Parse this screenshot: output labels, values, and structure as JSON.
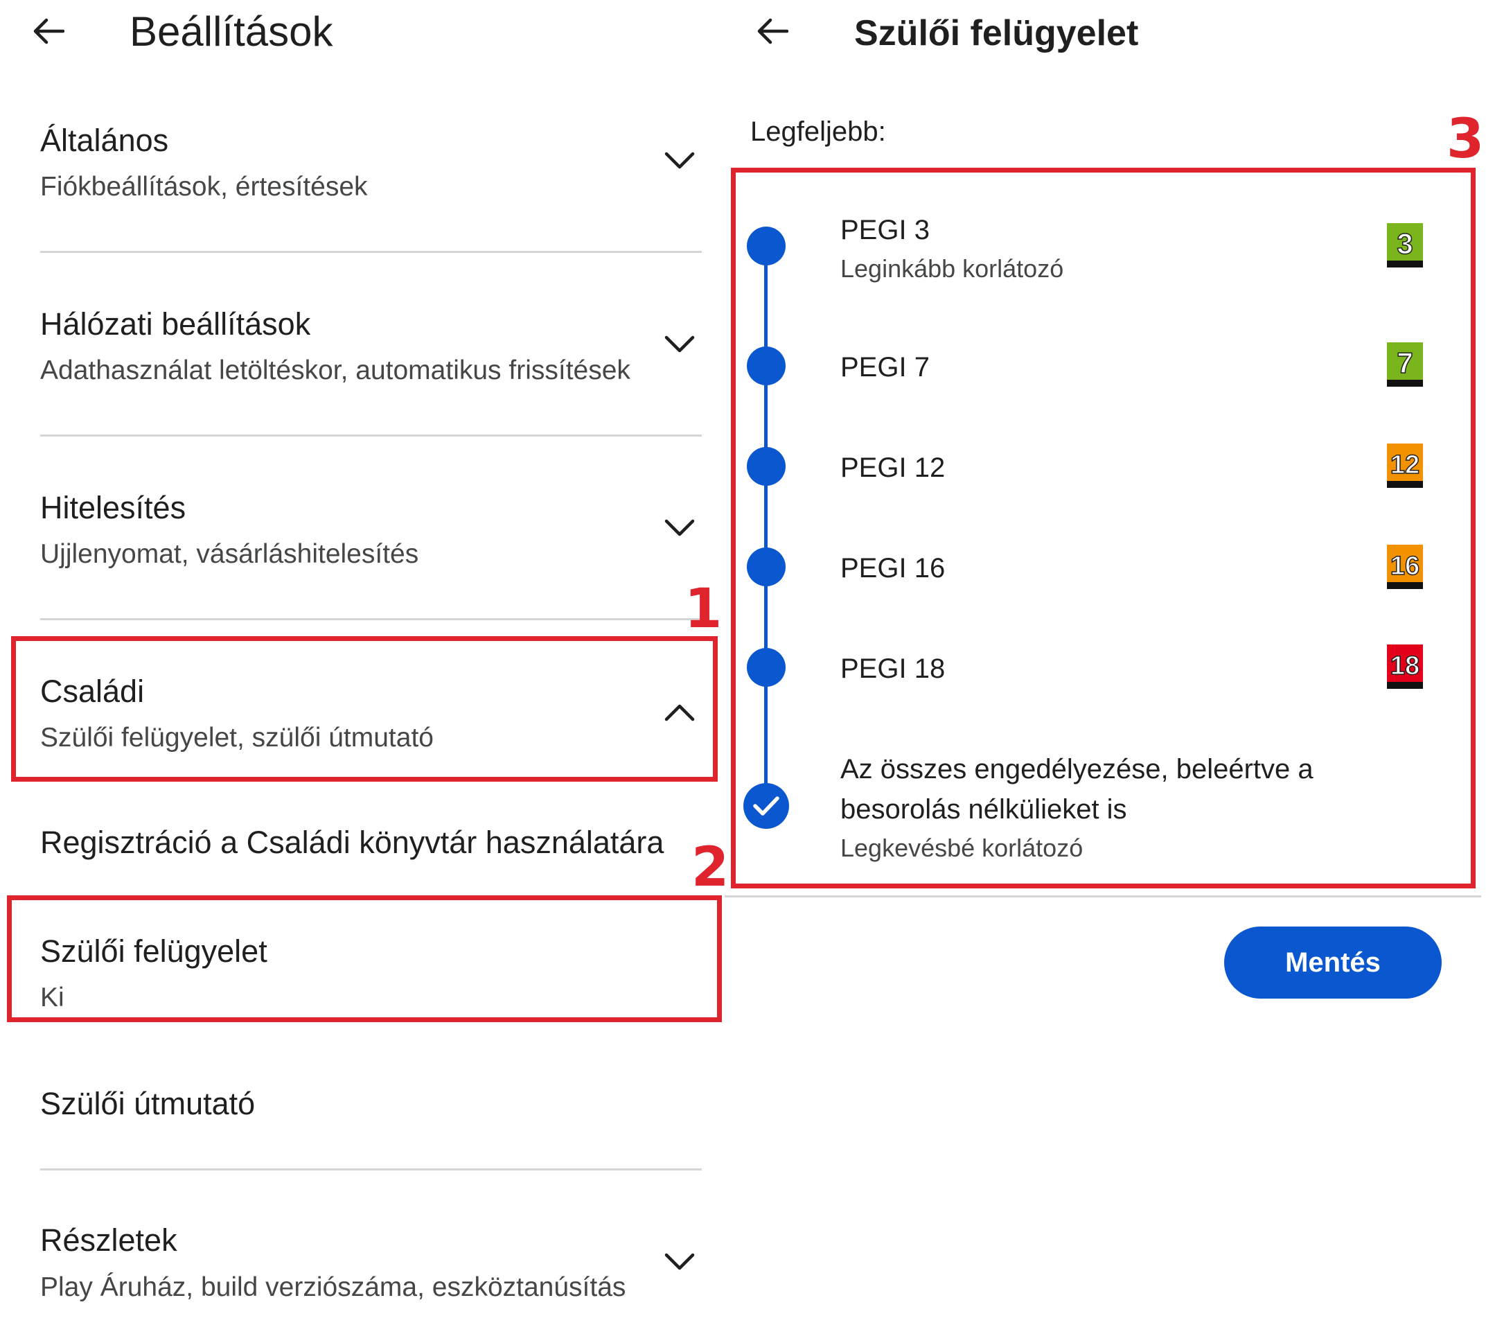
{
  "left": {
    "title": "Beállítások",
    "items": [
      {
        "title": "Általános",
        "subtitle": "Fiókbeállítások, értesítések"
      },
      {
        "title": "Hálózati beállítások",
        "subtitle": "Adathasználat letöltéskor, automatikus frissítések"
      },
      {
        "title": "Hitelesítés",
        "subtitle": "Ujjlenyomat, vásárláshitelesítés"
      },
      {
        "title": "Családi",
        "subtitle": "Szülői felügyelet, szülői útmutató"
      }
    ],
    "family_register": "Regisztráció a Családi könyvtár használatára",
    "parental_control": {
      "title": "Szülői felügyelet",
      "value": "Ki"
    },
    "parental_guide": "Szülői útmutató",
    "details": {
      "title": "Részletek",
      "subtitle": "Play Áruház, build verziószáma, eszköztanúsítás"
    }
  },
  "right": {
    "title": "Szülői felügyelet",
    "max_label": "Legfeljebb:",
    "options": [
      {
        "label": "PEGI 3",
        "sub": "Leginkább korlátozó",
        "badge": "3",
        "badge_color": "#7ab51d"
      },
      {
        "label": "PEGI 7",
        "badge": "7",
        "badge_color": "#7ab51d"
      },
      {
        "label": "PEGI 12",
        "badge": "12",
        "badge_color": "#f39200"
      },
      {
        "label": "PEGI 16",
        "badge": "16",
        "badge_color": "#f39200"
      },
      {
        "label": "PEGI 18",
        "badge": "18",
        "badge_color": "#e2001a"
      }
    ],
    "all": {
      "line1": "Az összes engedélyezése, beleértve a",
      "line2": "besorolás nélkülieket is",
      "sub": "Legkevésbé korlátozó"
    },
    "save": "Mentés"
  },
  "markers": {
    "one": "1",
    "two": "2",
    "three": "3"
  },
  "colors": {
    "accent": "#0b57d0",
    "annotation": "#e0242e",
    "divider": "#d5d5d5"
  }
}
